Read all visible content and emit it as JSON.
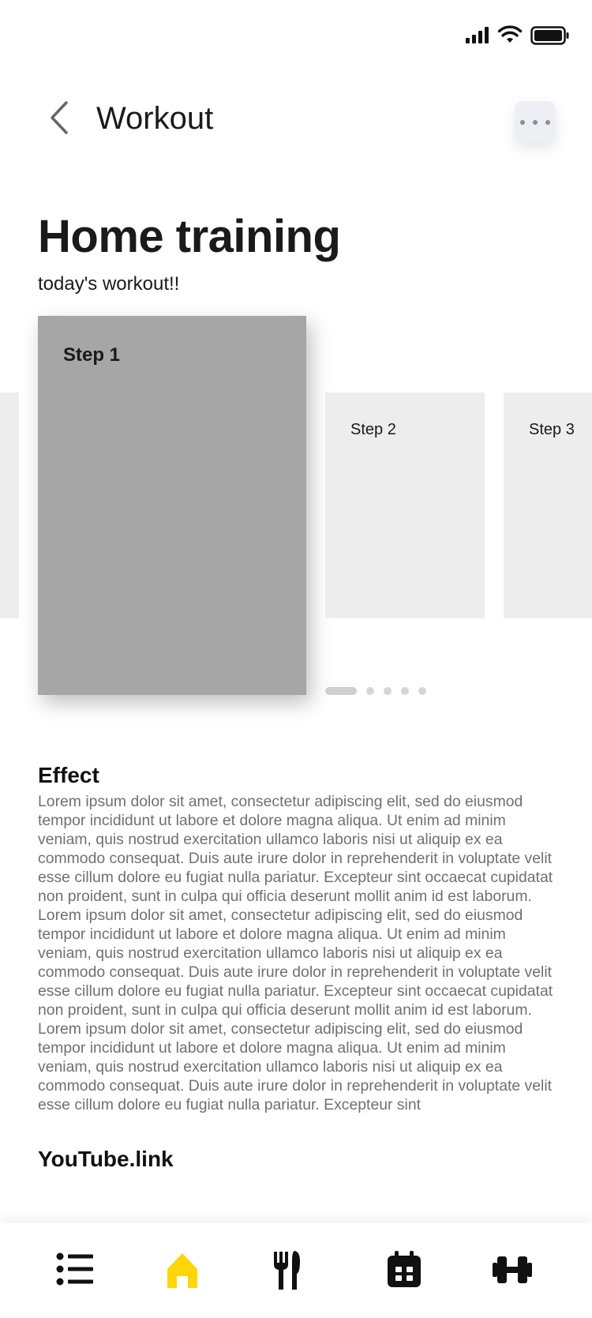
{
  "header": {
    "title": "Workout"
  },
  "page": {
    "title": "Home training",
    "subtitle": "today's workout!!"
  },
  "carousel": {
    "cards": [
      {
        "label": "Step 1",
        "active": true
      },
      {
        "label": "Step 2",
        "active": false
      },
      {
        "label": "Step 3",
        "active": false
      }
    ],
    "pagination": {
      "current": 1,
      "total": 5
    }
  },
  "effect": {
    "title": "Effect",
    "body": "Lorem ipsum dolor sit amet, consectetur adipiscing elit, sed do eiusmod tempor incididunt ut labore et dolore magna aliqua. Ut enim ad minim veniam, quis nostrud exercitation ullamco laboris nisi ut aliquip ex ea commodo consequat. Duis aute irure dolor in reprehenderit in voluptate velit esse cillum dolore eu fugiat nulla pariatur. Excepteur sint occaecat cupidatat non proident, sunt in culpa qui officia deserunt mollit anim id est laborum. Lorem ipsum dolor sit amet, consectetur adipiscing elit, sed do eiusmod tempor incididunt ut labore et dolore magna aliqua. Ut enim ad minim veniam, quis nostrud exercitation ullamco laboris nisi ut aliquip ex ea commodo consequat. Duis aute irure dolor in reprehenderit in voluptate velit esse cillum dolore eu fugiat nulla pariatur. Excepteur sint occaecat cupidatat non proident, sunt in culpa qui officia deserunt mollit anim id est laborum. Lorem ipsum dolor sit amet, consectetur adipiscing elit, sed do eiusmod tempor incididunt ut labore et dolore magna aliqua. Ut enim ad minim veniam, quis nostrud exercitation ullamco laboris nisi ut aliquip ex ea commodo consequat. Duis aute irure dolor in reprehenderit in voluptate velit esse cillum dolore eu fugiat nulla pariatur. Excepteur sint"
  },
  "youtube": {
    "title": "YouTube.link"
  },
  "tabbar": {
    "items": [
      {
        "icon": "list-icon",
        "active": false
      },
      {
        "icon": "home-icon",
        "active": true
      },
      {
        "icon": "fork-knife-icon",
        "active": false
      },
      {
        "icon": "calendar-icon",
        "active": false
      },
      {
        "icon": "dumbbell-icon",
        "active": false
      }
    ],
    "active_color": "#FFD60A",
    "inactive_color": "#111111"
  },
  "status_bar": {
    "icons": [
      "signal-icon",
      "wifi-icon",
      "battery-icon"
    ]
  }
}
